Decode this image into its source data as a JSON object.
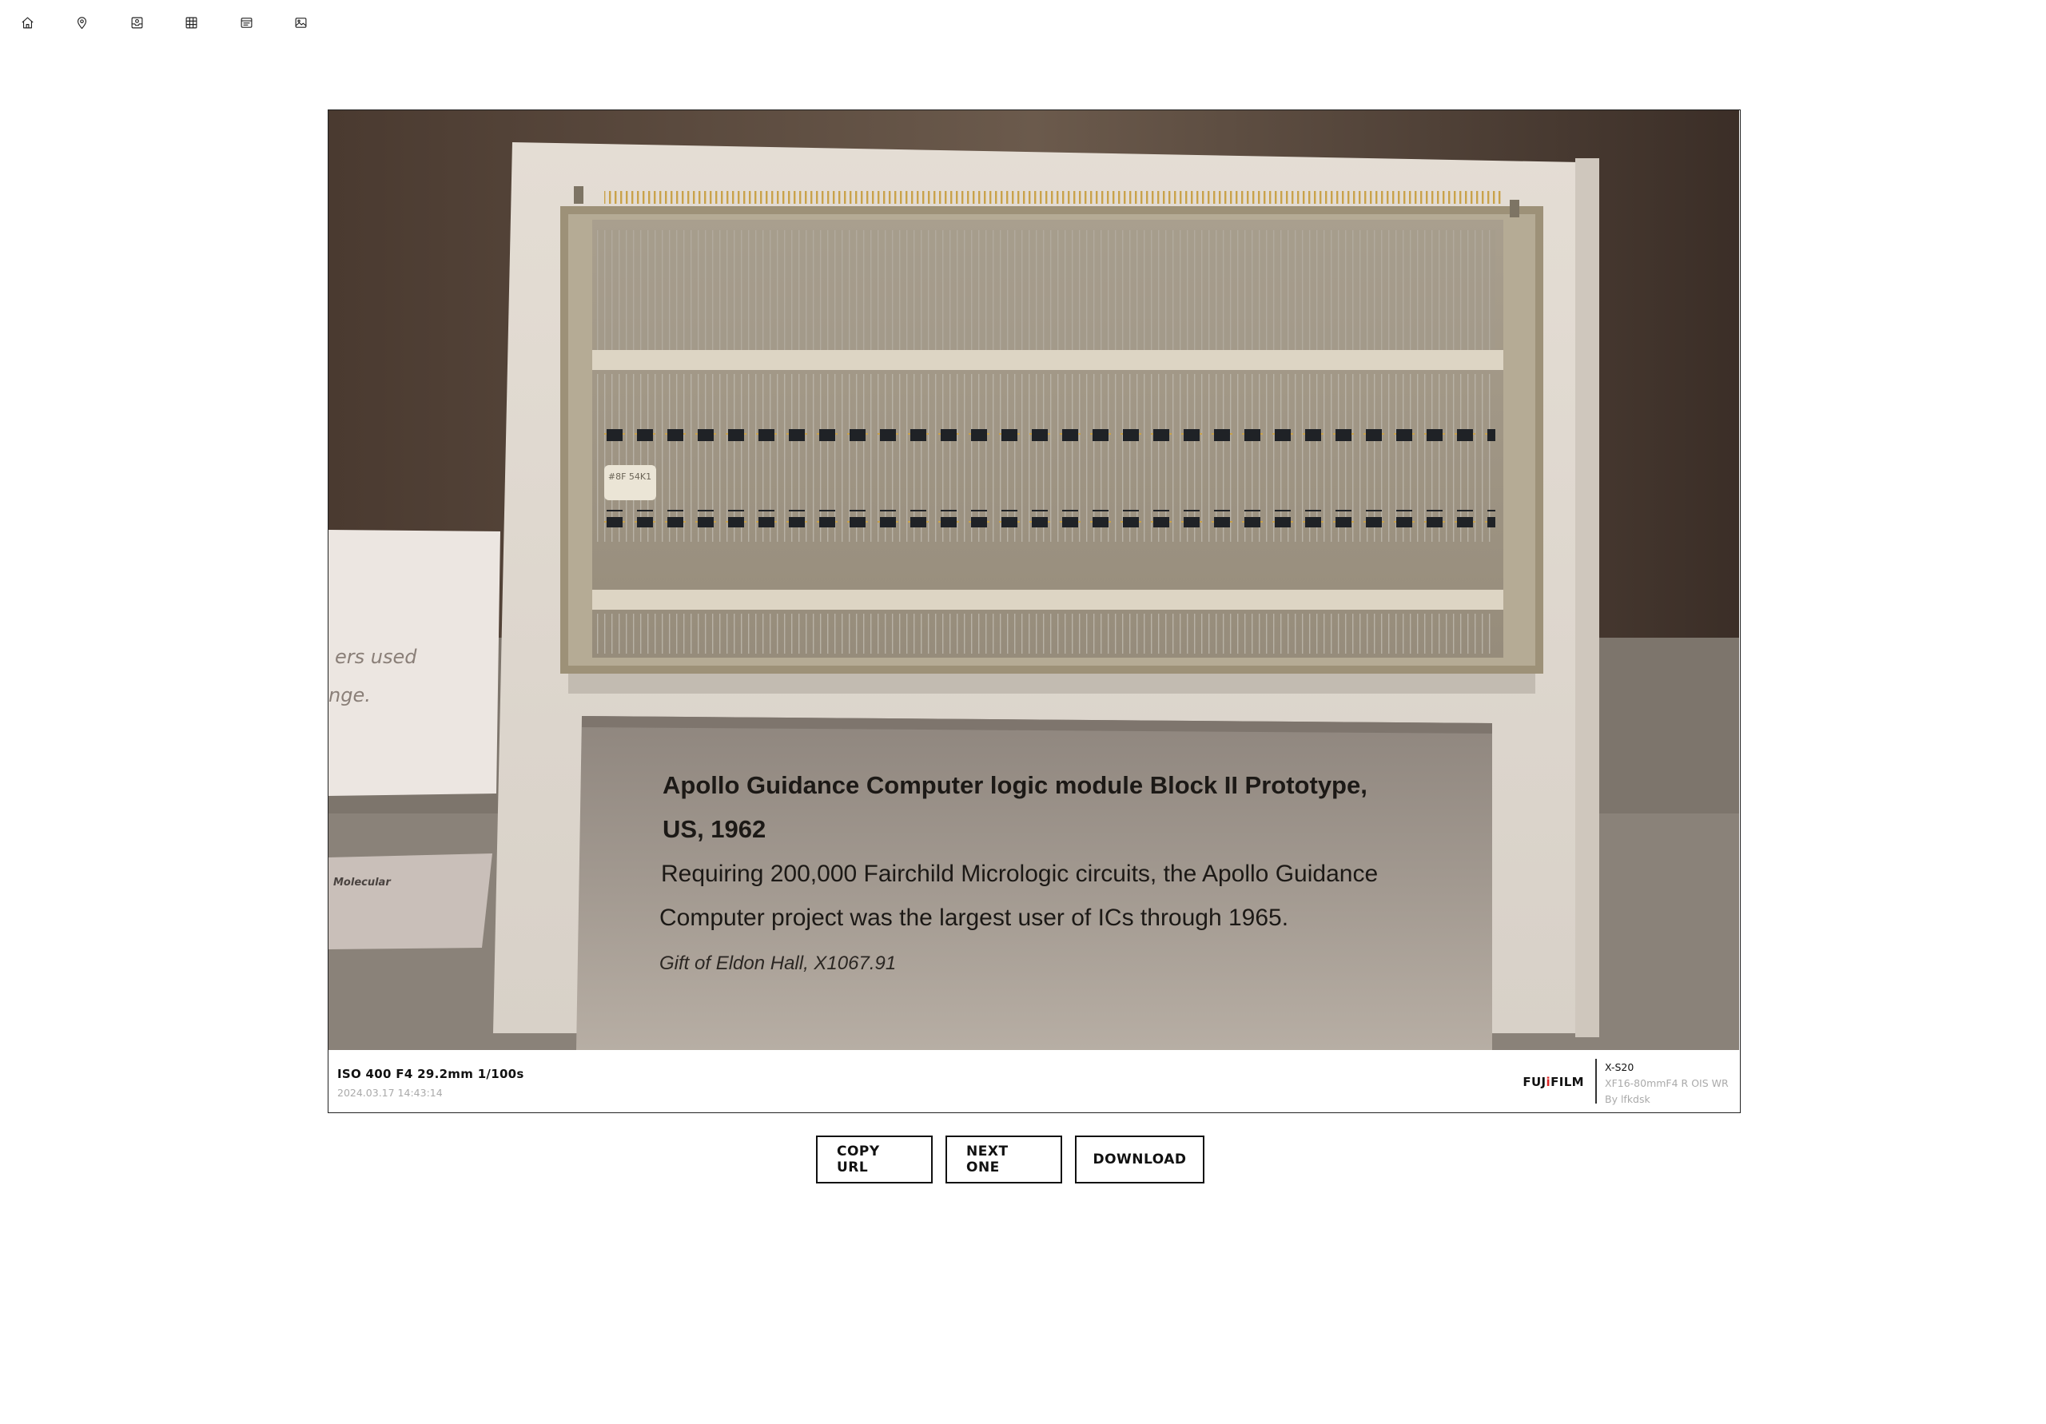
{
  "nav": {
    "items": [
      {
        "icon": "home-icon"
      },
      {
        "icon": "map-pin-icon"
      },
      {
        "icon": "inbox-icon"
      },
      {
        "icon": "grid-icon"
      },
      {
        "icon": "list-icon"
      },
      {
        "icon": "image-icon"
      }
    ]
  },
  "photo": {
    "placard": {
      "title_line1": "Apollo Guidance Computer logic module Block II Prototype,",
      "title_line2": "US, 1962",
      "body_line1": "Requiring 200,000 Fairchild Micrologic circuits, the Apollo Guidance",
      "body_line2": "Computer project was the largest user of ICs through 1965.",
      "credit": "Gift of Eldon Hall, X1067.91"
    },
    "side_card": {
      "line1": "ers used",
      "line2": "nge."
    },
    "side_label": "Molecular",
    "chip_label": "#8F\n54K1"
  },
  "caption": {
    "exif": "ISO 400 F4 29.2mm 1/100s",
    "datetime": "2024.03.17 14:43:14",
    "brand_prefix": "FUJ",
    "brand_i": "i",
    "brand_suffix": "FILM",
    "camera_model": "X-S20",
    "lens": "XF16-80mmF4 R OIS WR",
    "author": "By lfkdsk"
  },
  "actions": {
    "copy_url": "COPY URL",
    "next_one": "NEXT ONE",
    "download": "DOWNLOAD"
  }
}
